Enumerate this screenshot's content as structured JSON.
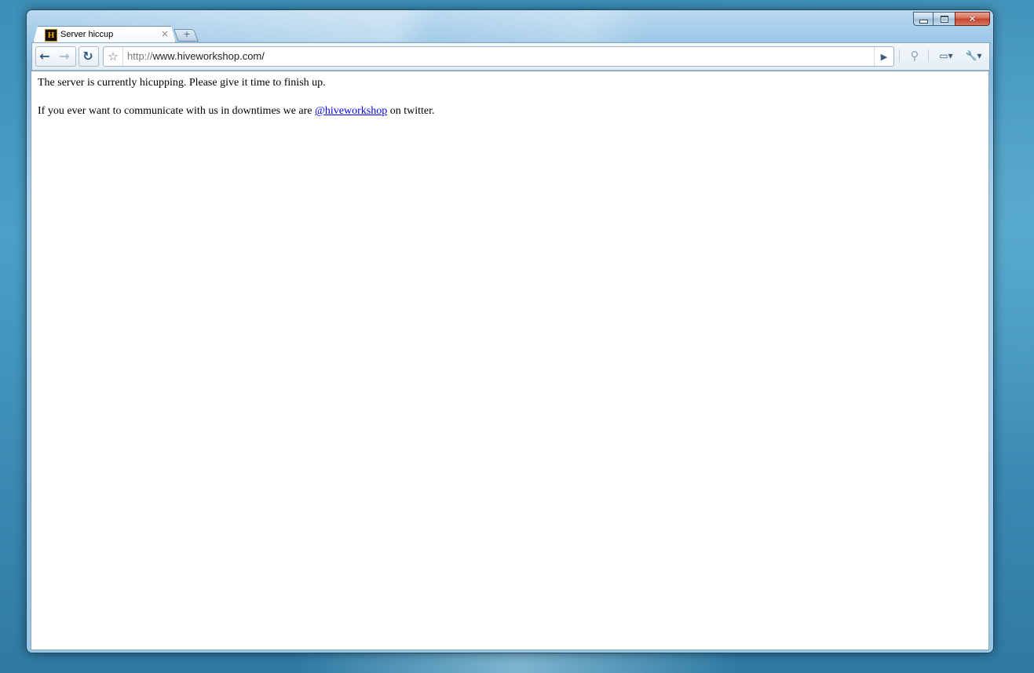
{
  "window": {
    "caption_buttons": {
      "minimize_icon": "minimize-icon",
      "maximize_icon": "maximize-icon",
      "close_icon": "close-icon",
      "close_glyph": "✕"
    }
  },
  "tabs": [
    {
      "title": "Server hiccup",
      "favicon_text": "H",
      "favicon_colors": {
        "bg": "#1a1208",
        "fg": "#f2b218"
      },
      "close_glyph": "×"
    }
  ],
  "new_tab": {
    "glyph": "+"
  },
  "toolbar": {
    "back_glyph": "←",
    "forward_glyph": "→",
    "reload_glyph": "↻",
    "star_glyph": "☆",
    "go_glyph": "▶",
    "search_glyph": "⚲",
    "page_glyph": "▭▾",
    "wrench_glyph": "🔧▾"
  },
  "address_bar": {
    "scheme": "http://",
    "host_path": "www.hiveworkshop.com/"
  },
  "page": {
    "line1": "The server is currently hicupping. Please give it time to finish up.",
    "line2_before": "If you ever want to communicate with us in downtimes we are ",
    "line2_link": "@hiveworkshop",
    "line2_after": " on twitter.",
    "link_color": "#0000ee"
  }
}
